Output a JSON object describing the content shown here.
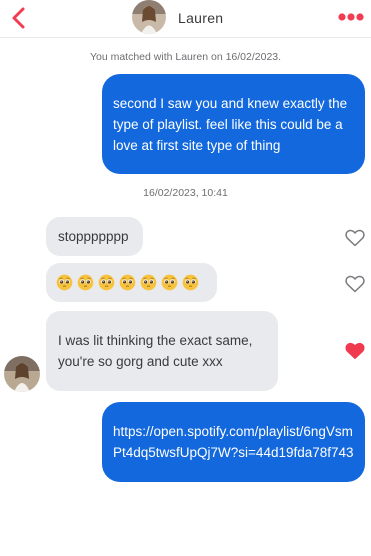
{
  "header": {
    "contact_name": "Lauren",
    "back_icon": "chevron-left-icon",
    "more_icon": "more-dots-icon",
    "accent_color": "#f23c52"
  },
  "conversation": {
    "match_note": "You matched with Lauren on 16/02/2023.",
    "timestamp": "16/02/2023, 10:41",
    "messages": [
      {
        "direction": "sent",
        "text": "second I saw you and knew exactly the type of playlist. feel like this could be a love at first site type of thing"
      },
      {
        "direction": "received",
        "text": "stoppppppp",
        "liked": false
      },
      {
        "direction": "received",
        "emoji": "pleading-face",
        "emoji_count": 7,
        "liked": false
      },
      {
        "direction": "received",
        "text": "I was lit thinking the exact same, you're so gorg and cute xxx",
        "liked": true
      },
      {
        "direction": "sent",
        "text": "https://open.spotify.com/playlist/6ngVsmPt4dq5twsfUpQj7W?si=44d19fda78f743"
      }
    ]
  },
  "colors": {
    "sent_bubble": "#1268dc",
    "received_bubble": "#e9eaee",
    "liked_heart": "#f0394f"
  }
}
